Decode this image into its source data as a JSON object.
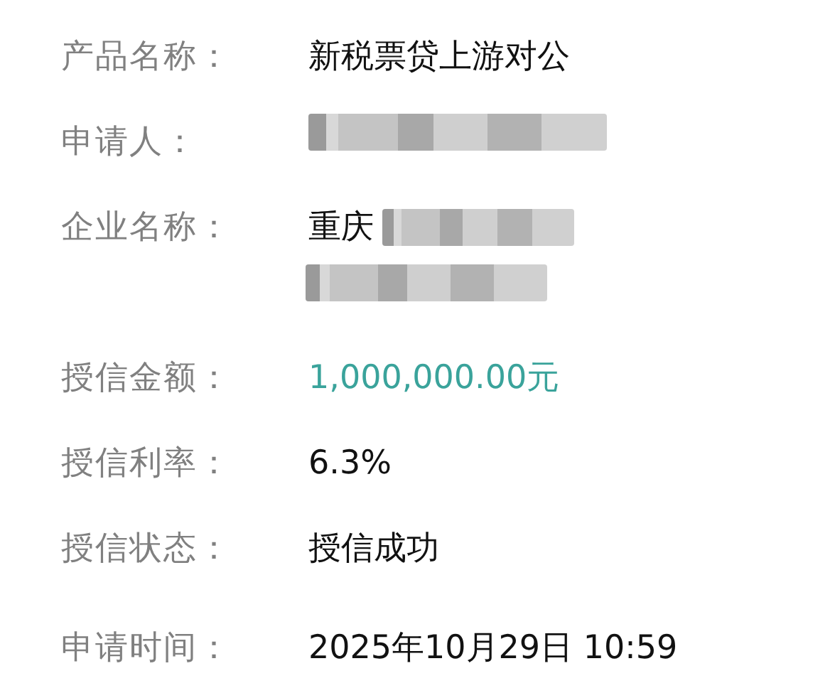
{
  "fields": [
    {
      "label": "产品名称：",
      "value": "新税票贷上游对公",
      "kind": "text",
      "redacted": false
    },
    {
      "label": "申请人：",
      "redacted": true
    },
    {
      "label": "企业名称：",
      "value": "重庆",
      "kind": "text",
      "redacted": true
    },
    {
      "label": "授信金额：",
      "value": "1,000,000.00元",
      "kind": "amount",
      "redacted": false
    },
    {
      "label": "授信利率：",
      "value": "6.3%",
      "kind": "text",
      "redacted": false
    },
    {
      "label": "授信状态：",
      "value": "授信成功",
      "kind": "text",
      "redacted": false
    },
    {
      "label": "申请时间：",
      "value": "2025年10月29日 10:59",
      "kind": "text",
      "redacted": false
    }
  ]
}
